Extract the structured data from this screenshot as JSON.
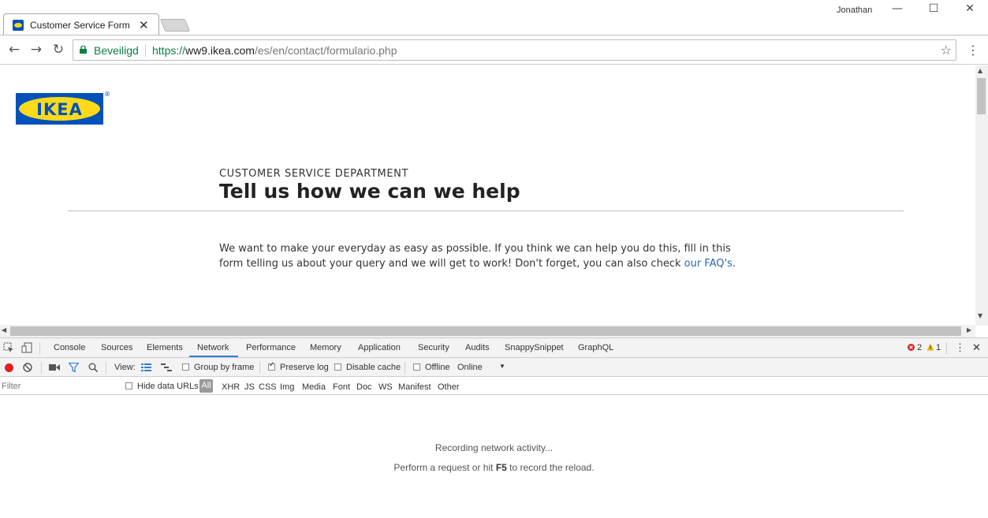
{
  "window": {
    "profile_name": "Jonathan",
    "minimize_glyph": "—",
    "maximize_glyph": "☐",
    "close_glyph": "✕"
  },
  "tab": {
    "title": "Customer Service Form -",
    "close_glyph": "✕"
  },
  "addressbar": {
    "secure_label": "Beveiligd",
    "url_scheme": "https://",
    "url_host": "ww9.ikea.com",
    "url_path": "/es/en/contact/formulario.php",
    "back_glyph": "←",
    "forward_glyph": "→",
    "reload_glyph": "↻",
    "star_glyph": "☆",
    "menu_glyph": "⋮"
  },
  "page": {
    "logo_text": "IKEA",
    "logo_reg": "®",
    "department": "CUSTOMER SERVICE DEPARTMENT",
    "headline": "Tell us how we can we help",
    "intro_text": "We want to make your everyday as easy as possible. If you think we can help you do this, fill in this form telling us about your query and we will get to work! Don't forget, you can also check ",
    "faq_link": "our FAQ's",
    "intro_end": "."
  },
  "devtools": {
    "tabs": [
      "Console",
      "Sources",
      "Elements",
      "Network",
      "Performance",
      "Memory",
      "Application",
      "Security",
      "Audits",
      "SnappySnippet",
      "GraphQL"
    ],
    "active_tab": "Network",
    "error_count": "2",
    "warning_count": "1",
    "toolbar": {
      "view_label": "View:",
      "group_by_frame": "Group by frame",
      "preserve_log": "Preserve log",
      "disable_cache": "Disable cache",
      "offline": "Offline",
      "throttle": "Online",
      "throttle_caret": "▼"
    },
    "filterbar": {
      "filter_placeholder": "Filter",
      "hide_data_urls": "Hide data URLs",
      "types": [
        "All",
        "XHR",
        "JS",
        "CSS",
        "Img",
        "Media",
        "Font",
        "Doc",
        "WS",
        "Manifest",
        "Other"
      ]
    },
    "empty": {
      "line1": "Recording network activity...",
      "line2_pre": "Perform a request or hit ",
      "line2_key": "F5",
      "line2_post": " to record the reload."
    }
  },
  "colors": {
    "ikea_blue": "#0051ba",
    "ikea_yellow": "#ffda1a",
    "secure_green": "#0b8043",
    "link_blue": "#2a6aa8",
    "devtools_active": "#3879d9",
    "record_red": "#e01f1f"
  }
}
